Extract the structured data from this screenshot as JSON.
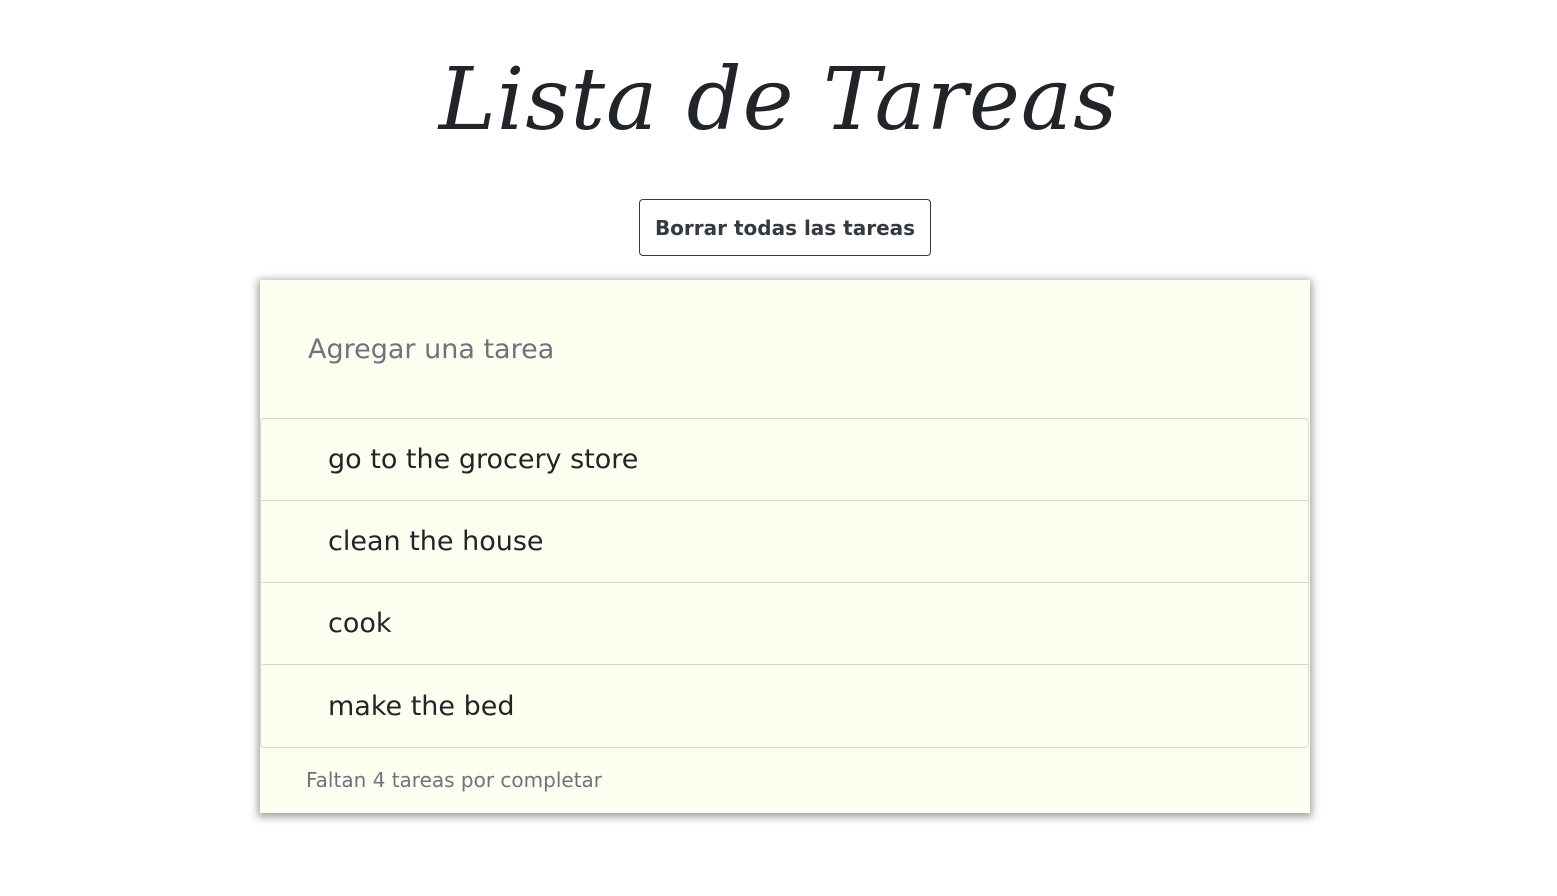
{
  "header": {
    "title": "Lista de Tareas"
  },
  "actions": {
    "clear_all_label": "Borrar todas las tareas"
  },
  "input": {
    "placeholder": "Agregar una tarea",
    "value": ""
  },
  "tasks": [
    {
      "label": "go to the grocery store"
    },
    {
      "label": "clean the house"
    },
    {
      "label": "cook"
    },
    {
      "label": "make the bed"
    }
  ],
  "footer": {
    "remaining_text": "Faltan 4 tareas por completar"
  },
  "colors": {
    "card_background": "#fefef0",
    "text": "#212529",
    "muted_text": "#6c757d",
    "button_border": "#343a40"
  }
}
